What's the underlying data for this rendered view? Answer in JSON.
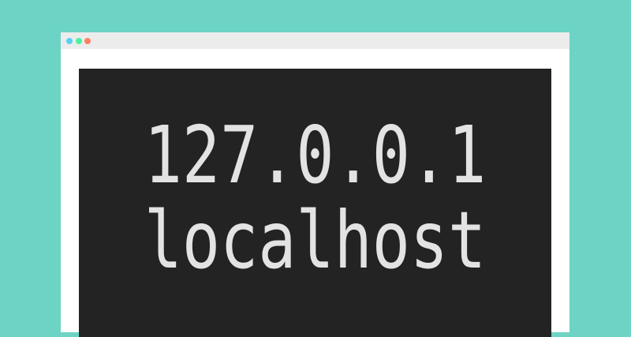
{
  "window": {
    "controls": [
      {
        "name": "close",
        "color": "#5ad0ee"
      },
      {
        "name": "minimize",
        "color": "#4cf1a0"
      },
      {
        "name": "maximize",
        "color": "#ff7f62"
      }
    ]
  },
  "content": {
    "line1": "127.0.0.1",
    "line2": "localhost"
  },
  "colors": {
    "background": "#6dd3c5",
    "panel": "#232323",
    "text": "#e3e3e3"
  }
}
